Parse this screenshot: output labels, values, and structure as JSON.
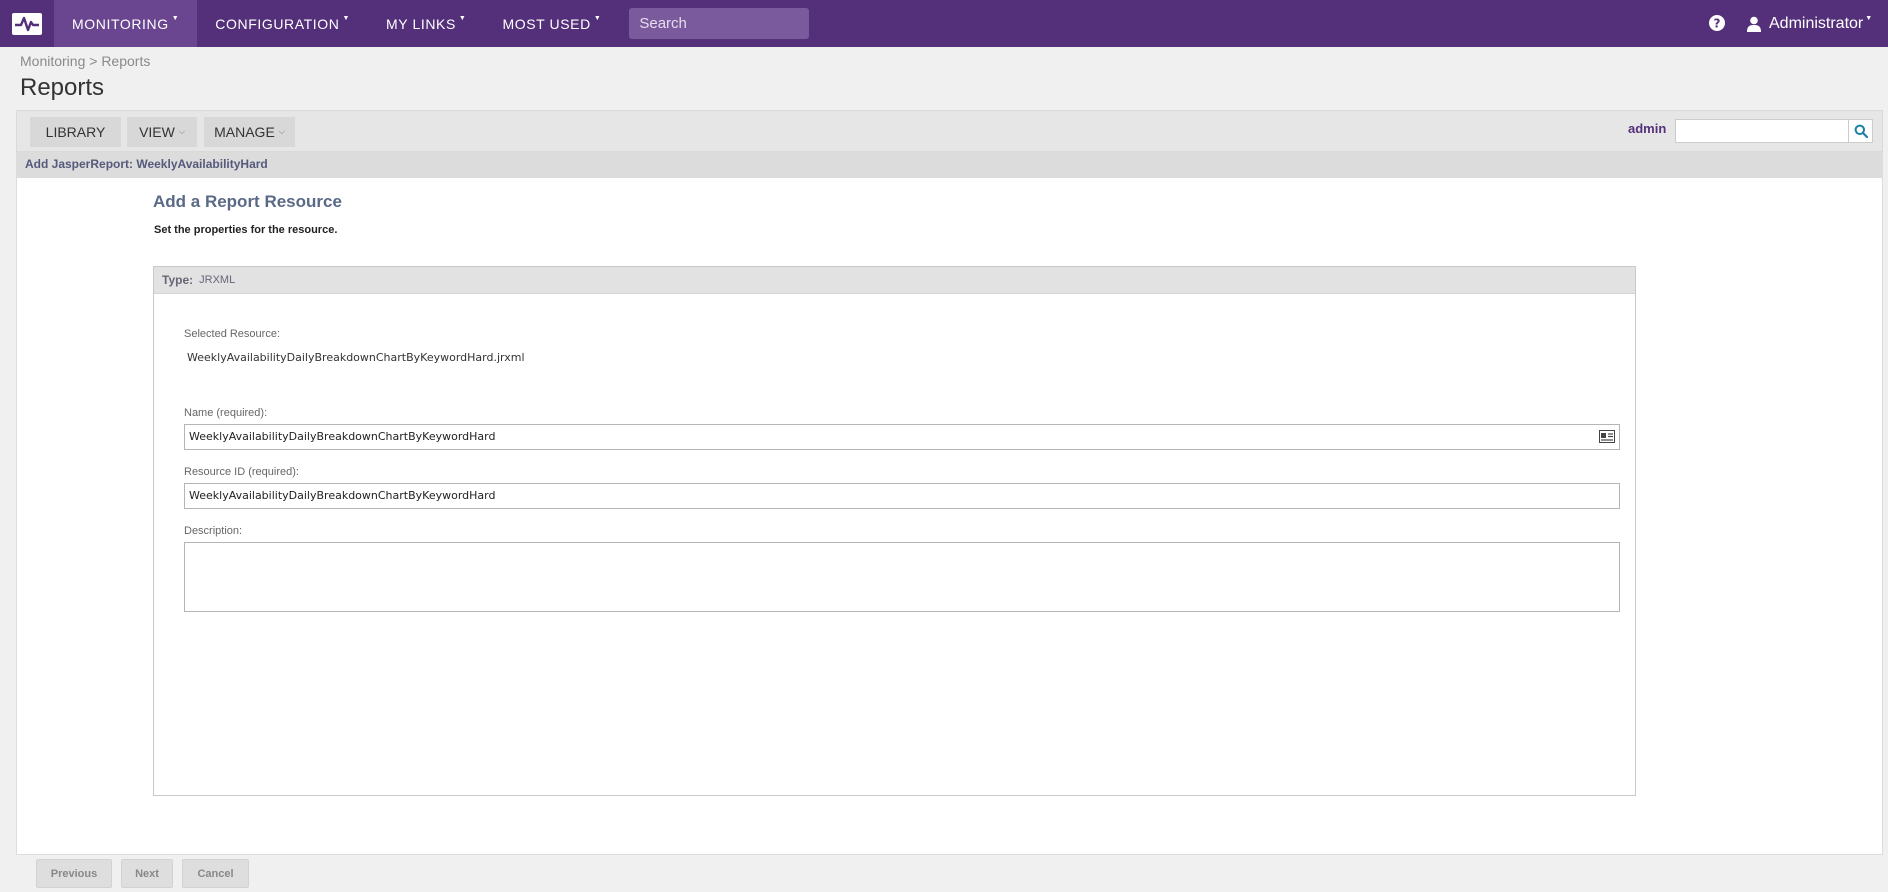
{
  "nav": {
    "items": [
      {
        "label": "MONITORING",
        "active": true
      },
      {
        "label": "CONFIGURATION",
        "active": false
      },
      {
        "label": "MY LINKS",
        "active": false
      },
      {
        "label": "MOST USED",
        "active": false
      }
    ],
    "search_placeholder": "Search",
    "user": "Administrator",
    "brand_color": "#55307a",
    "active_color": "#6a4690"
  },
  "breadcrumb": "Monitoring > Reports",
  "page_title": "Reports",
  "toolbar": {
    "library": "LIBRARY",
    "view": "VIEW",
    "manage": "MANAGE",
    "user": "admin"
  },
  "subheader": "Add JasperReport: WeeklyAvailabilityHard",
  "form": {
    "title": "Add a Report Resource",
    "description": "Set the properties for the resource.",
    "type_label": "Type:",
    "type_value": "JRXML",
    "selected_resource_label": "Selected Resource:",
    "selected_resource_value": "WeeklyAvailabilityDailyBreakdownChartByKeywordHard.jrxml",
    "name_label": "Name (required):",
    "name_value": "WeeklyAvailabilityDailyBreakdownChartByKeywordHard",
    "resource_id_label": "Resource ID (required):",
    "resource_id_value": "WeeklyAvailabilityDailyBreakdownChartByKeywordHard",
    "description_label": "Description:",
    "description_value": ""
  },
  "footer": {
    "previous": "Previous",
    "next": "Next",
    "cancel": "Cancel"
  }
}
